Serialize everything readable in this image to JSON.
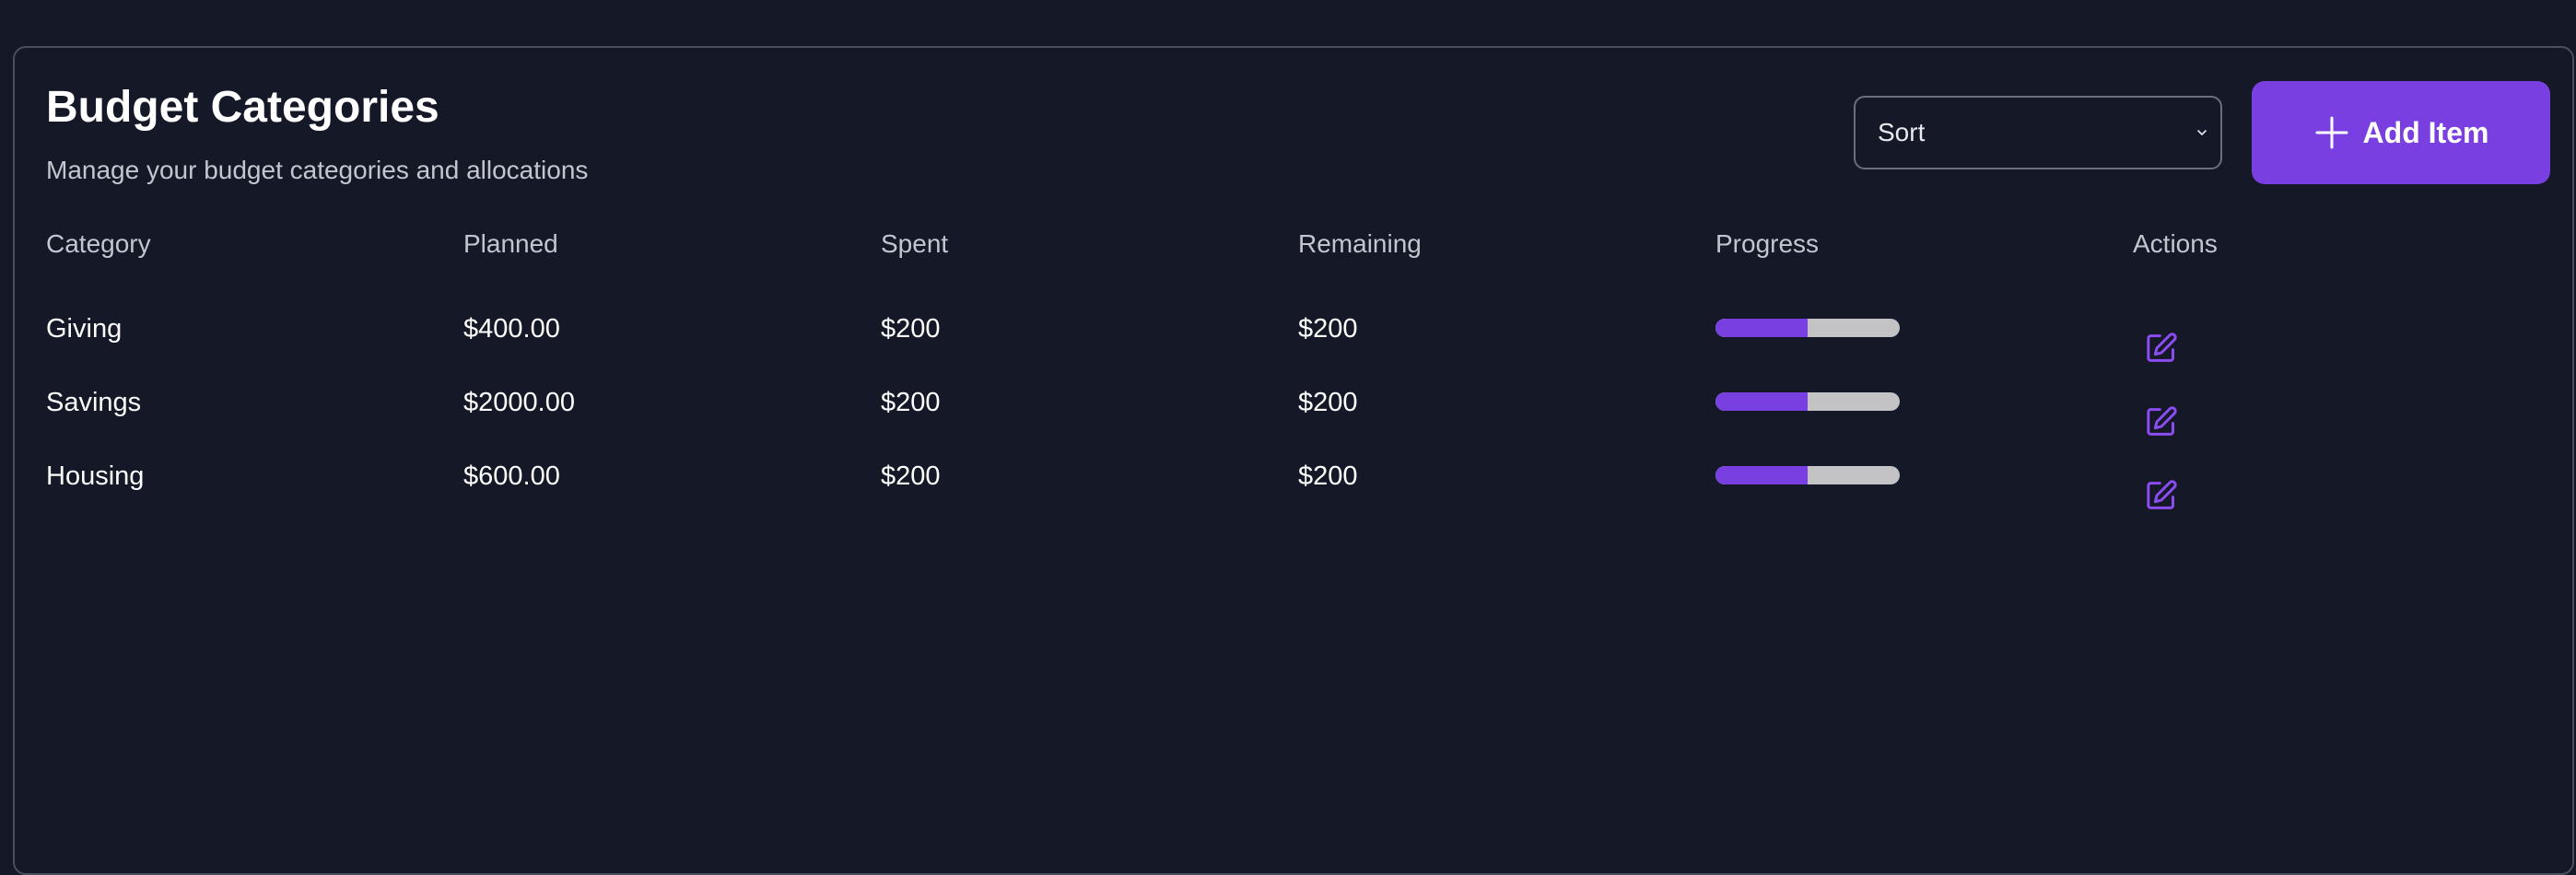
{
  "header": {
    "title": "Budget Categories",
    "subtitle": "Manage your budget categories and allocations"
  },
  "sort": {
    "value": "Sort"
  },
  "add_button": {
    "label": "Add Item",
    "icon": "plus-icon"
  },
  "table": {
    "columns": [
      "Category",
      "Planned",
      "Spent",
      "Remaining",
      "Progress",
      "Actions"
    ],
    "rows": [
      {
        "category": "Giving",
        "planned": "$400.00",
        "spent": "$200",
        "remaining": "$200",
        "progress": 0.5,
        "action_icon": "edit-icon"
      },
      {
        "category": "Savings",
        "planned": "$2000.00",
        "spent": "$200",
        "remaining": "$200",
        "progress": 0.5,
        "action_icon": "edit-icon"
      },
      {
        "category": "Housing",
        "planned": "$600.00",
        "spent": "$200",
        "remaining": "$200",
        "progress": 0.5,
        "action_icon": "edit-icon"
      }
    ]
  },
  "colors": {
    "background": "#141827",
    "accent": "#7a3fe0",
    "progress_track": "#c3c3c5",
    "muted_text": "#c4c6cf"
  }
}
